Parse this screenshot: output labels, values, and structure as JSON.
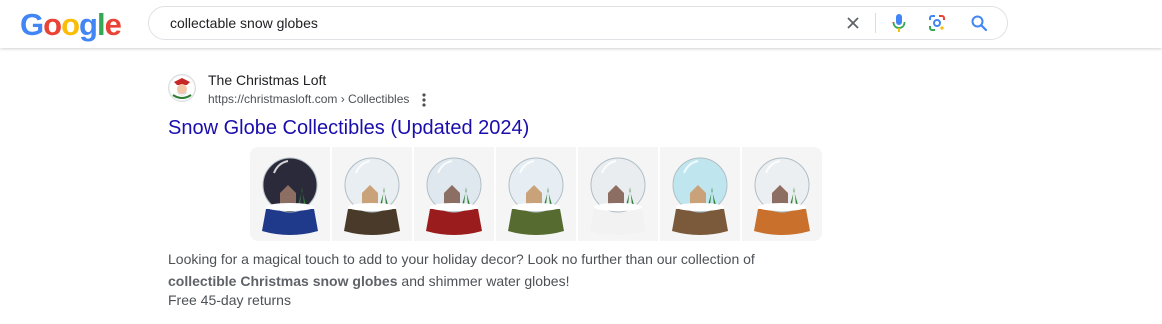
{
  "logo": {
    "letters": [
      "G",
      "o",
      "o",
      "g",
      "l",
      "e"
    ],
    "colors": [
      "#4285F4",
      "#EA4335",
      "#FBBC05",
      "#4285F4",
      "#34A853",
      "#EA4335"
    ]
  },
  "search": {
    "query": "collectable snow globes"
  },
  "icons": {
    "clear": "close-icon",
    "voice": "microphone-icon",
    "lens": "lens-icon",
    "search": "search-icon"
  },
  "result": {
    "site_name": "The Christmas Loft",
    "site_url": "https://christmasloft.com › Collectibles",
    "title": "Snow Globe Collectibles (Updated 2024)",
    "snippet_part1": "Looking for a magical touch to add to your holiday decor? Look no further than our collection of ",
    "snippet_bold": "collectible Christmas snow globes",
    "snippet_part2": " and shimmer water globes!",
    "returns": "Free 45-day returns",
    "thumbnails": [
      {
        "name": "santa-sleigh-globe",
        "globe": "#2a2a3a",
        "base": "#1f3a8a"
      },
      {
        "name": "village-train-globe",
        "globe": "#e8eef2",
        "base": "#4a3a2a"
      },
      {
        "name": "book-base-globe",
        "globe": "#dfe8ee",
        "base": "#9b1c1c"
      },
      {
        "name": "winter-cottage-globe",
        "globe": "#e6eef3",
        "base": "#556b2f"
      },
      {
        "name": "white-house-globe",
        "globe": "#e9edf0",
        "base": "#f2f2f2"
      },
      {
        "name": "blue-village-globe",
        "globe": "#bfe6ee",
        "base": "#7a5a3a"
      },
      {
        "name": "gingerbread-globe",
        "globe": "#eceff1",
        "base": "#c8702c"
      }
    ]
  }
}
